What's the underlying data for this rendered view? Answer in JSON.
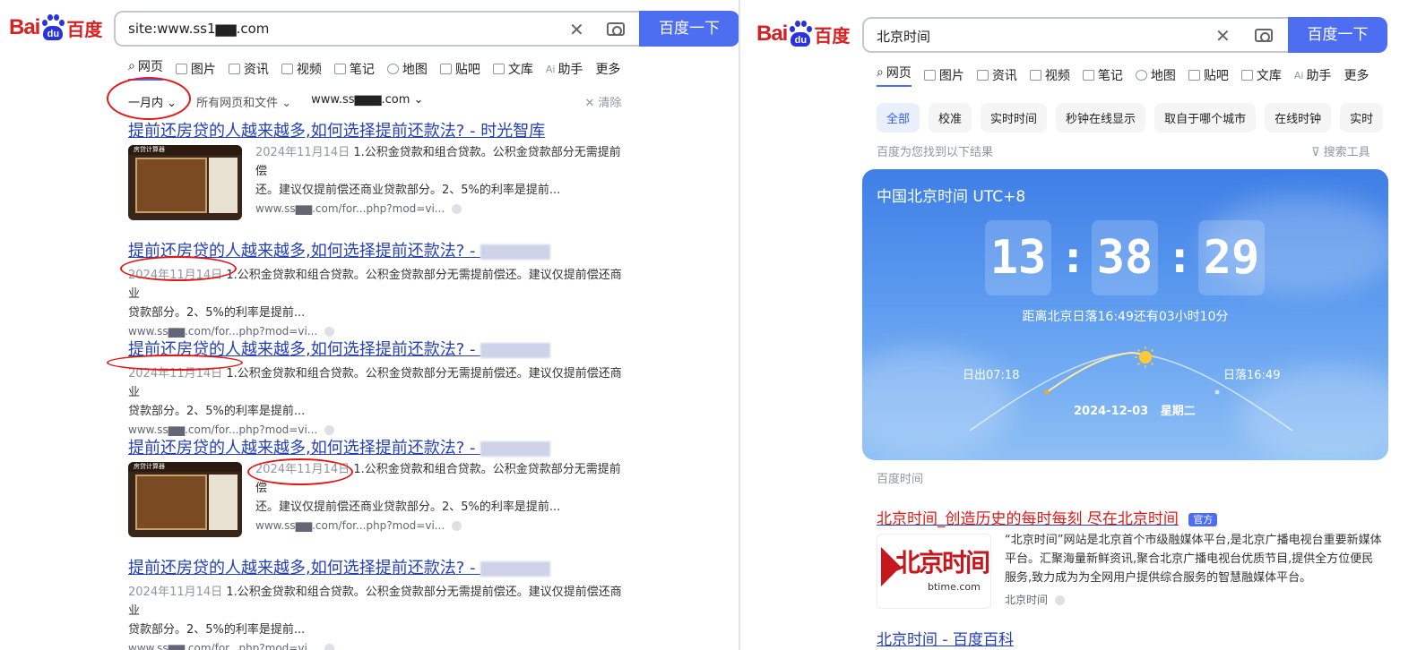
{
  "left": {
    "logo": {
      "bai": "Bai",
      "du": "du",
      "cn": "百度"
    },
    "search": {
      "query": "site:www.ss1▆▆.com",
      "button": "百度一下"
    },
    "tabs": [
      {
        "label": "网页"
      },
      {
        "label": "图片"
      },
      {
        "label": "资讯"
      },
      {
        "label": "视频"
      },
      {
        "label": "笔记"
      },
      {
        "label": "地图"
      },
      {
        "label": "贴吧"
      },
      {
        "label": "文库"
      },
      {
        "label": "助手"
      },
      {
        "label": "更多"
      }
    ],
    "filters": {
      "time": "一月内",
      "type": "所有网页和文件",
      "site": "www.ss▆▆▆.com",
      "clear": "清除"
    },
    "results": [
      {
        "title": "提前还房贷的人越来越多,如何选择提前还款法? - 时光智库",
        "date": "2024年11月14日",
        "desc1": "1.公积金贷款和组合贷款。公积金贷款部分无需提前偿",
        "desc2": "还。建议仅提前偿还商业贷款部分。2、5%的利率是提前...",
        "url": "www.ss▆▆.com/for...php?mod=vi...",
        "thumb_label": "房贷计算器"
      },
      {
        "title": "提前还房贷的人越来越多,如何选择提前还款法? - ",
        "date": "2024年11月14日",
        "desc1": "1.公积金贷款和组合贷款。公积金贷款部分无需提前偿还。建议仅提前偿还商业",
        "desc2": "贷款部分。2、5%的利率是提前...",
        "url": "www.ss▆▆.com/for...php?mod=vi..."
      },
      {
        "title": "提前还房贷的人越来越多,如何选择提前还款法? - ",
        "date": "2024年11月14日",
        "desc1": "1.公积金贷款和组合贷款。公积金贷款部分无需提前偿还。建议仅提前偿还商业",
        "desc2": "贷款部分。2、5%的利率是提前...",
        "url": "www.ss▆▆.com/for...php?mod=vi..."
      },
      {
        "title": "提前还房贷的人越来越多,如何选择提前还款法? - ",
        "date": "2024年11月14日",
        "desc1": "1.公积金贷款和组合贷款。公积金贷款部分无需提前偿",
        "desc2": "还。建议仅提前偿还商业贷款部分。2、5%的利率是提前...",
        "url": "www.ss▆▆.com/for...php?mod=vi...",
        "thumb_label": "房贷计算器"
      },
      {
        "title": "提前还房贷的人越来越多,如何选择提前还款法? - ",
        "date": "2024年11月14日",
        "desc1": "1.公积金贷款和组合贷款。公积金贷款部分无需提前偿还。建议仅提前偿还商业",
        "desc2": "贷款部分。2、5%的利率是提前...",
        "url": "www.ss▆▆.com/for...php?mod=vi..."
      }
    ]
  },
  "right": {
    "logo": {
      "bai": "Bai",
      "du": "du",
      "cn": "百度"
    },
    "search": {
      "query": "北京时间",
      "button": "百度一下"
    },
    "tabs": [
      {
        "label": "网页"
      },
      {
        "label": "图片"
      },
      {
        "label": "资讯"
      },
      {
        "label": "视频"
      },
      {
        "label": "笔记"
      },
      {
        "label": "地图"
      },
      {
        "label": "贴吧"
      },
      {
        "label": "文库"
      },
      {
        "label": "助手"
      },
      {
        "label": "更多"
      }
    ],
    "chips": [
      "全部",
      "校准",
      "实时时间",
      "秒钟在线显示",
      "取自于哪个城市",
      "在线时钟",
      "实时"
    ],
    "found_text": "百度为您找到以下结果",
    "tools": "搜索工具",
    "clock": {
      "title": "中国北京时间 UTC+8",
      "hh": "13",
      "mm": "38",
      "ss": "29",
      "sunset_info": "距离北京日落16:49还有03小时10分",
      "sunrise": "日出07:18",
      "sunset": "日落16:49",
      "date": "2024-12-03",
      "weekday": "星期二"
    },
    "source": "百度时间",
    "result1": {
      "title": "北京时间_创造历史的每时每刻 尽在北京时间",
      "badge": "官方",
      "desc1": "“北京时间”网站是北京首个市级融媒体平台,是北京广播电视台重要新媒体",
      "desc2": "平台。汇聚海量新鲜资讯,聚合北京广播电视台优质节目,提供全方位便民",
      "desc3": "服务,致力成为为全网用户提供综合服务的智慧融媒体平台。",
      "site": "北京时间",
      "logo_cn": "北京时间",
      "logo_en": "btime.com"
    },
    "result2": {
      "title": "北京时间 - 百度百科"
    }
  },
  "colors": {
    "accent": "#4e6ef2",
    "link": "#2440b3",
    "red": "#e01919",
    "official": "#315efb"
  }
}
